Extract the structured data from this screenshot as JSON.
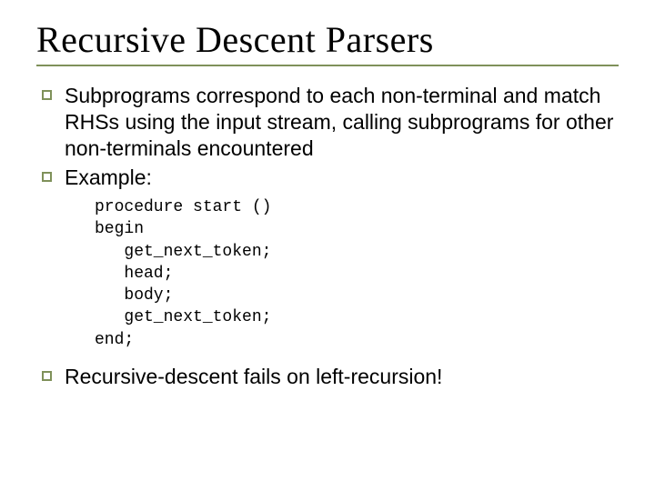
{
  "title": "Recursive Descent Parsers",
  "bullets": {
    "b1": "Subprograms correspond to each non-terminal and match RHSs using the input stream, calling subprograms for other non-terminals encountered",
    "b2": "Example:",
    "b3": "Recursive-descent fails on left-recursion!"
  },
  "code": {
    "l1": "procedure start ()",
    "l2": "begin",
    "l3": "   get_next_token;",
    "l4": "   head;",
    "l5": "   body;",
    "l6": "   get_next_token;",
    "l7": "end;"
  }
}
